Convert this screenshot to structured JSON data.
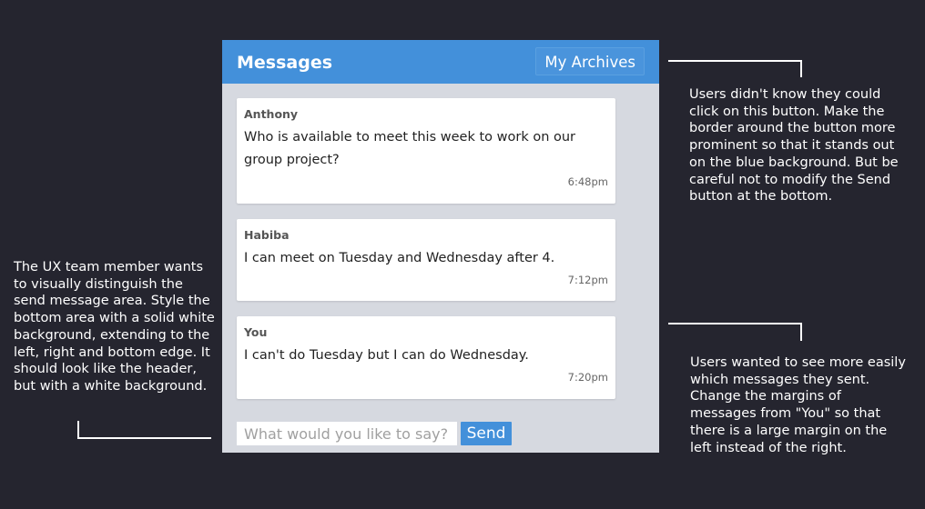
{
  "header": {
    "title": "Messages",
    "archives_label": "My Archives"
  },
  "messages": [
    {
      "sender": "Anthony",
      "text": "Who is available to meet this week to work on our group project?",
      "time": "6:48pm"
    },
    {
      "sender": "Habiba",
      "text": "I can meet on Tuesday and Wednesday after 4.",
      "time": "7:12pm"
    },
    {
      "sender": "You",
      "text": "I can't do Tuesday but I can do Wednesday.",
      "time": "7:20pm"
    }
  ],
  "composer": {
    "placeholder": "What would you like to say?",
    "send_label": "Send"
  },
  "notes": {
    "top_right": "Users didn't know they could click on this button. Make the border around the button more prominent so that it stands out on the blue background. But be careful not to modify the Send button at the bottom.",
    "bottom_right": "Users wanted to see more easily which messages they sent. Change the margins of messages from \"You\" so that there is a large margin on the left instead of the right.",
    "left": "The UX team member wants to visually distinguish the send message area. Style the bottom area with a solid white background, extending to the left, right and bottom edge. It should look like the header, but with a white background."
  }
}
